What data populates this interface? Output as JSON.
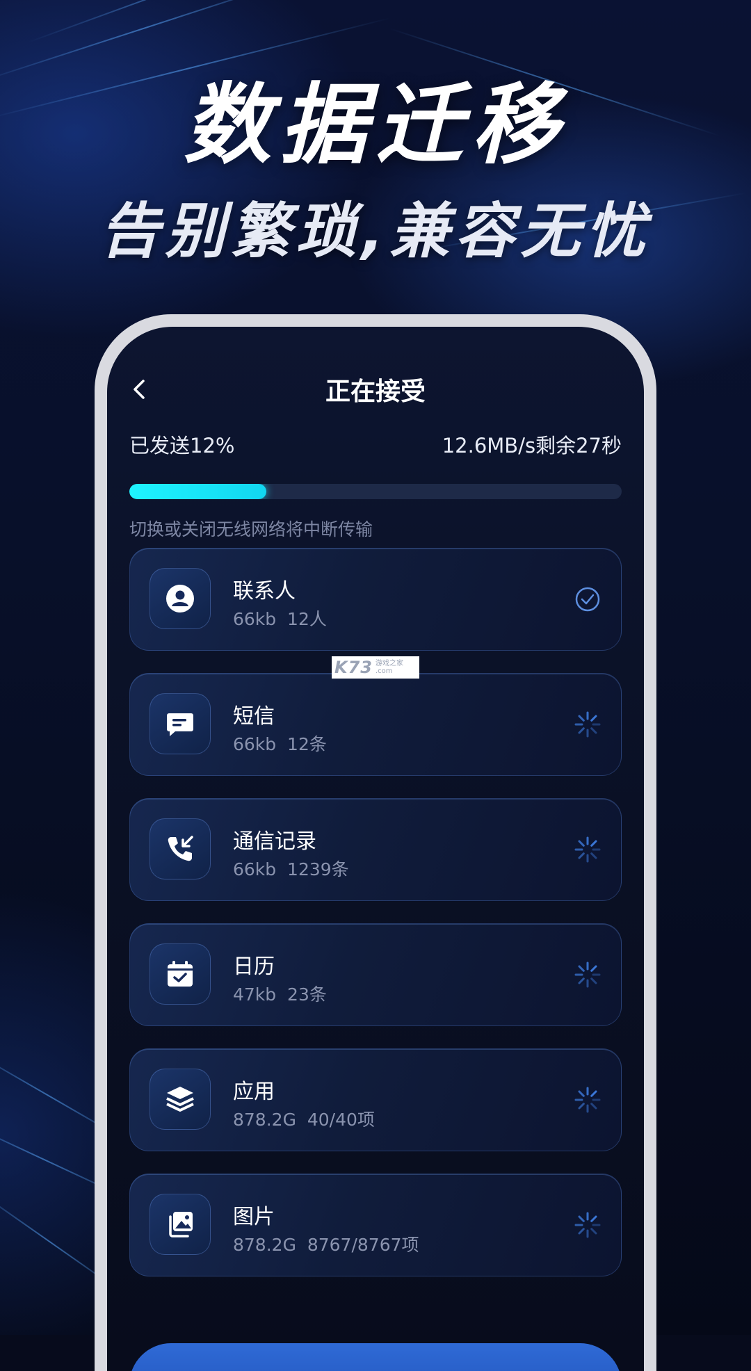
{
  "hero": {
    "title": "数据迁移",
    "subtitle": "告别繁琐,兼容无忧"
  },
  "nav": {
    "back_icon": "chevron-left-icon",
    "title": "正在接受"
  },
  "progress": {
    "sent_label": "已发送12%",
    "speed_label": "12.6MB/s剩余27秒",
    "percent": 12,
    "warning": "切换或关闭无线网络将中断传输"
  },
  "items": [
    {
      "name": "联系人",
      "meta": "66kb  12人",
      "icon": "contact-icon",
      "status": "done"
    },
    {
      "name": "短信",
      "meta": "66kb  12条",
      "icon": "message-icon",
      "status": "loading"
    },
    {
      "name": "通信记录",
      "meta": "66kb  1239条",
      "icon": "phone-call-icon",
      "status": "loading"
    },
    {
      "name": "日历",
      "meta": "47kb  23条",
      "icon": "calendar-icon",
      "status": "loading"
    },
    {
      "name": "应用",
      "meta": "878.2G  40/40项",
      "icon": "layers-icon",
      "status": "loading"
    },
    {
      "name": "图片",
      "meta": "878.2G  8767/8767项",
      "icon": "images-icon",
      "status": "loading"
    }
  ],
  "watermark": {
    "logo": "K73",
    "tagline": "游戏之家",
    "domain": ".com"
  },
  "colors": {
    "progress_fill": "#1ff4ff",
    "check": "#5d8fe0",
    "spinner": "#3f7fe4"
  }
}
